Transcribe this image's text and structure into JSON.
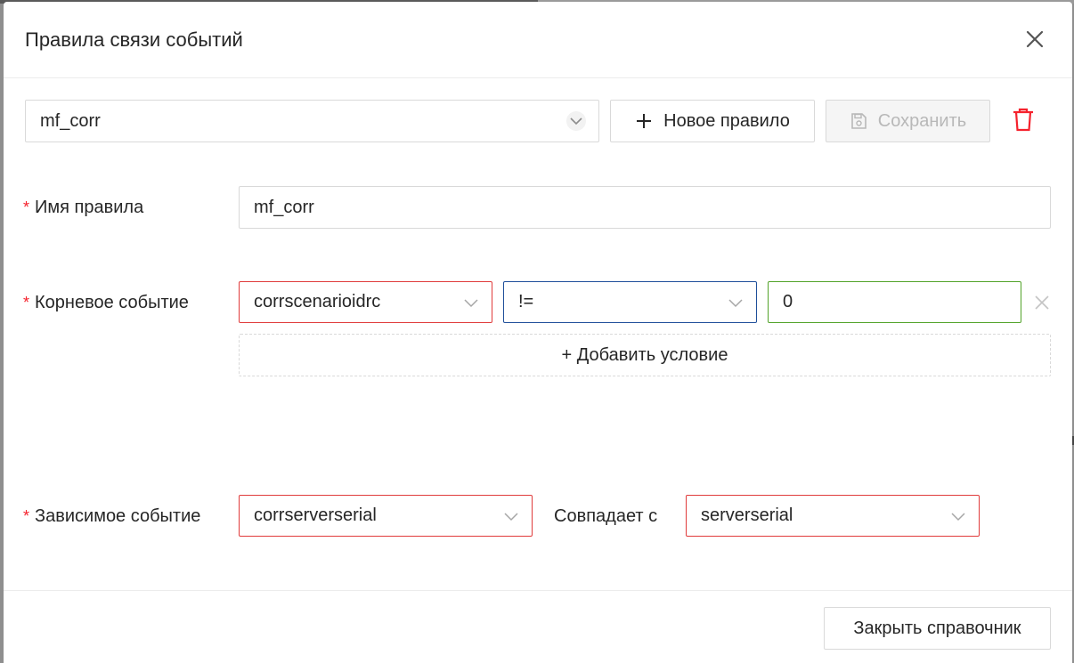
{
  "dialog": {
    "title": "Правила связи событий"
  },
  "toolbar": {
    "rule_select_value": "mf_corr",
    "new_rule_label": "Новое правило",
    "save_label": "Сохранить"
  },
  "form": {
    "rule_name": {
      "label": "Имя правила",
      "value": "mf_corr"
    },
    "root_event": {
      "label": "Корневое событие",
      "field_value": "corrscenarioidrc",
      "operator_value": "!=",
      "condition_value": "0",
      "add_condition_label": "+ Добавить условие"
    },
    "dependent_event": {
      "label": "Зависимое событие",
      "field_value": "corrserverserial",
      "match_label": "Совпадает с",
      "match_value": "serverserial"
    },
    "required_mark": "*"
  },
  "footer": {
    "close_label": "Закрыть справочник"
  },
  "colors": {
    "error_border": "#e03b3b",
    "focus_border": "#1f4f9a",
    "success_border": "#52a32a",
    "danger_icon": "#f5222d"
  },
  "icons": {
    "close": "close-icon",
    "chevron": "chevron-down-icon",
    "plus": "plus-icon",
    "save": "floppy-disk-icon",
    "delete": "trash-icon",
    "remove": "close-small-icon"
  }
}
